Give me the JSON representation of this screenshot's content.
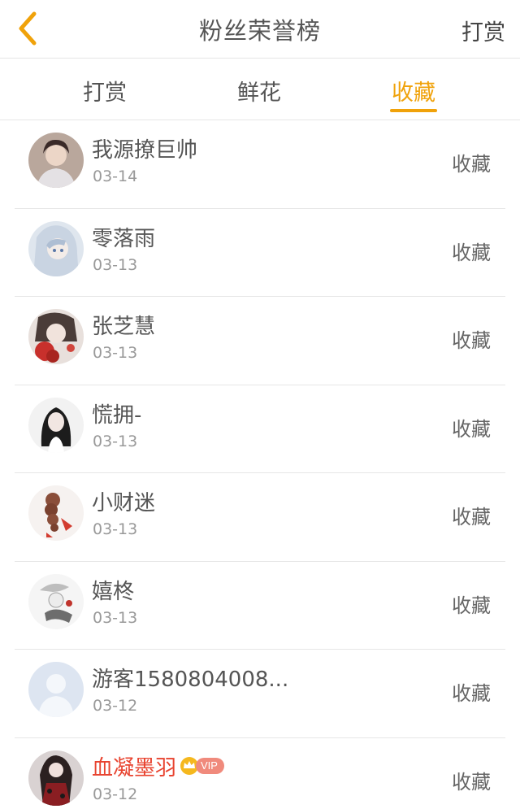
{
  "header": {
    "title": "粉丝荣誉榜",
    "action_label": "打赏",
    "back_icon": "chevron-left-icon"
  },
  "tabs": [
    {
      "label": "打赏",
      "active": false
    },
    {
      "label": "鲜花",
      "active": false
    },
    {
      "label": "收藏",
      "active": true
    }
  ],
  "colors": {
    "accent": "#f0a20a",
    "vip_name": "#e8432f",
    "text": "#555555",
    "muted": "#999999"
  },
  "fans": [
    {
      "name": "我源撩巨帅",
      "date": "03-14",
      "action": "收藏",
      "avatar": "avatar-photo-woman"
    },
    {
      "name": "零落雨",
      "date": "03-13",
      "action": "收藏",
      "avatar": "avatar-anime-girl"
    },
    {
      "name": "张芝慧",
      "date": "03-13",
      "action": "收藏",
      "avatar": "avatar-art-girl"
    },
    {
      "name": "慌拥-",
      "date": "03-13",
      "action": "收藏",
      "avatar": "avatar-photo-girl"
    },
    {
      "name": "小财迷",
      "date": "03-13",
      "action": "收藏",
      "avatar": "avatar-braid"
    },
    {
      "name": "嬉柊",
      "date": "03-13",
      "action": "收藏",
      "avatar": "avatar-ink-art"
    },
    {
      "name": "游客1580804008...",
      "date": "03-12",
      "action": "收藏",
      "avatar": "avatar-default-person"
    },
    {
      "name": "血凝墨羽",
      "date": "03-12",
      "action": "收藏",
      "avatar": "avatar-gothic",
      "vip": true,
      "vip_label": "VIP"
    }
  ]
}
